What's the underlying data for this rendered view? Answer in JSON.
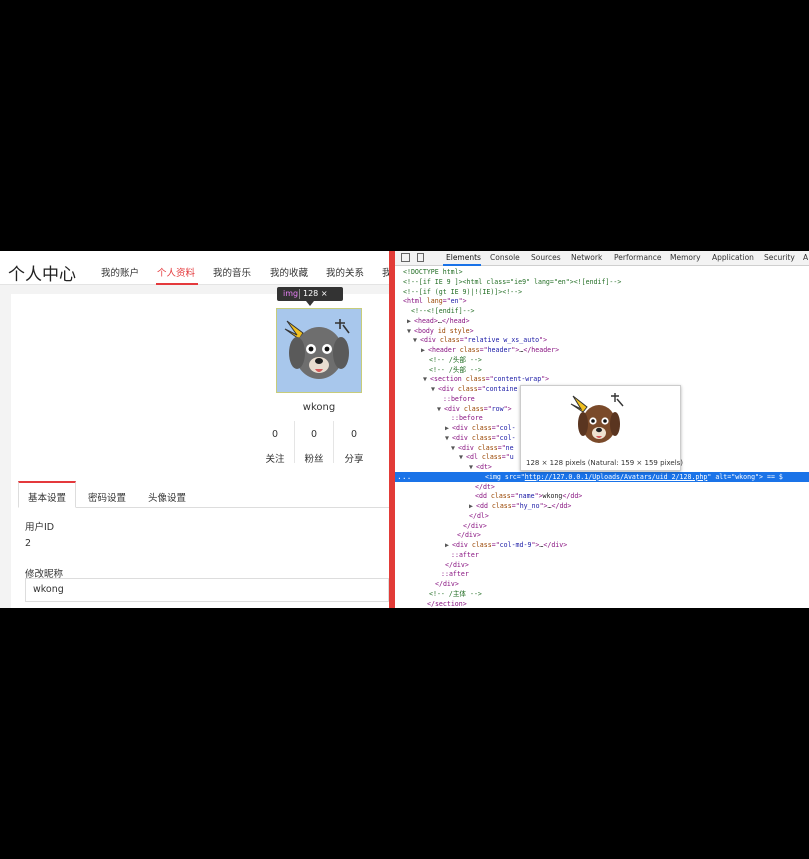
{
  "left": {
    "title": "个人中心",
    "nav": [
      "我的账户",
      "个人资料",
      "我的音乐",
      "我的收藏",
      "我的关系",
      "我"
    ],
    "active_nav": "个人资料",
    "tooltip": {
      "tag": "img",
      "dims": "128 × 128"
    },
    "username": "wkong",
    "stats": [
      {
        "value": "0",
        "label": "关注"
      },
      {
        "value": "0",
        "label": "粉丝"
      },
      {
        "value": "0",
        "label": "分享"
      }
    ],
    "tabs": [
      "基本设置",
      "密码设置",
      "头像设置"
    ],
    "active_tab": "基本设置",
    "user_id_label": "用户ID",
    "user_id_value": "2",
    "nickname_label": "修改昵称",
    "nickname_value": "wkong"
  },
  "devtools": {
    "tabs": [
      "Elements",
      "Console",
      "Sources",
      "Network",
      "Performance",
      "Memory",
      "Application",
      "Security",
      "A"
    ],
    "active_tab": "Elements",
    "preview_caption": "128 × 128 pixels (Natural: 159 × 159 pixels)",
    "selected_src": "http://127.0.0.1/Uploads/Avatars/uid_2/128.php",
    "selected_alt": "wkong",
    "selected_tail": "== $",
    "ellipsis": "...",
    "lines": [
      {
        "tri": "",
        "parts": [
          [
            "c-comment",
            "<!DOCTYPE html>"
          ]
        ]
      },
      {
        "tri": "",
        "parts": [
          [
            "c-comment",
            "<!--[if IE 9 ]><html class=\"ie9\" lang=\"en\"><![endif]-->"
          ]
        ]
      },
      {
        "tri": "",
        "parts": [
          [
            "c-comment",
            "<!--[if (gt IE 9)|!(IE)]><!-->"
          ]
        ]
      },
      {
        "tri": "",
        "parts": [
          [
            "c-tag",
            "<html "
          ],
          [
            "c-attr",
            "lang"
          ],
          [
            "c-tag",
            "=\""
          ],
          [
            "c-val",
            "en"
          ],
          [
            "c-tag",
            "\">"
          ]
        ]
      },
      {
        "tri": "",
        "parts": [
          [
            "c-comment",
            "<!--<![endif]-->"
          ]
        ]
      },
      {
        "tri": "▶",
        "parts": [
          [
            "c-tag",
            "<head>"
          ],
          [
            "c-text",
            "…"
          ],
          [
            "c-tag",
            "</head>"
          ]
        ]
      },
      {
        "tri": "▼",
        "parts": [
          [
            "c-tag",
            "<body "
          ],
          [
            "c-attr",
            "id style"
          ],
          [
            "c-tag",
            ">"
          ]
        ]
      },
      {
        "tri": "▼",
        "parts": [
          [
            "c-tag",
            "<div "
          ],
          [
            "c-attr",
            "class"
          ],
          [
            "c-tag",
            "=\""
          ],
          [
            "c-val",
            "relative w_xs_auto"
          ],
          [
            "c-tag",
            "\">"
          ]
        ]
      },
      {
        "tri": "▶",
        "parts": [
          [
            "c-tag",
            "<header "
          ],
          [
            "c-attr",
            "class"
          ],
          [
            "c-tag",
            "=\""
          ],
          [
            "c-val",
            "header"
          ],
          [
            "c-tag",
            "\">"
          ],
          [
            "c-text",
            "…"
          ],
          [
            "c-tag",
            "</header>"
          ]
        ]
      },
      {
        "tri": "",
        "parts": [
          [
            "c-comment",
            "<!-- /头部 -->"
          ]
        ]
      },
      {
        "tri": "",
        "parts": [
          [
            "c-comment",
            "<!-- /头部 -->"
          ]
        ]
      },
      {
        "tri": "▼",
        "parts": [
          [
            "c-tag",
            "<section "
          ],
          [
            "c-attr",
            "class"
          ],
          [
            "c-tag",
            "=\""
          ],
          [
            "c-val",
            "content-wrap"
          ],
          [
            "c-tag",
            "\">"
          ]
        ]
      },
      {
        "tri": "▼",
        "parts": [
          [
            "c-tag",
            "<div "
          ],
          [
            "c-attr",
            "class"
          ],
          [
            "c-tag",
            "=\""
          ],
          [
            "c-val",
            "containe"
          ]
        ]
      },
      {
        "tri": "",
        "parts": [
          [
            "c-pseudo",
            "::before"
          ]
        ]
      },
      {
        "tri": "▼",
        "parts": [
          [
            "c-tag",
            "<div "
          ],
          [
            "c-attr",
            "class"
          ],
          [
            "c-tag",
            "=\""
          ],
          [
            "c-val",
            "row"
          ],
          [
            "c-tag",
            "\">"
          ]
        ]
      },
      {
        "tri": "",
        "parts": [
          [
            "c-pseudo",
            "::before"
          ]
        ]
      },
      {
        "tri": "▶",
        "parts": [
          [
            "c-tag",
            "<div "
          ],
          [
            "c-attr",
            "class"
          ],
          [
            "c-tag",
            "=\""
          ],
          [
            "c-val",
            "col-"
          ]
        ]
      },
      {
        "tri": "▼",
        "parts": [
          [
            "c-tag",
            "<div "
          ],
          [
            "c-attr",
            "class"
          ],
          [
            "c-tag",
            "=\""
          ],
          [
            "c-val",
            "col-"
          ]
        ]
      },
      {
        "tri": "▼",
        "parts": [
          [
            "c-tag",
            "<div "
          ],
          [
            "c-attr",
            "class"
          ],
          [
            "c-tag",
            "=\""
          ],
          [
            "c-val",
            "ne"
          ]
        ]
      },
      {
        "tri": "▼",
        "parts": [
          [
            "c-tag",
            "<dl "
          ],
          [
            "c-attr",
            "class"
          ],
          [
            "c-tag",
            "=\""
          ],
          [
            "c-val",
            "u"
          ]
        ]
      },
      {
        "tri": "▼",
        "parts": [
          [
            "c-tag",
            "<dt>"
          ]
        ]
      },
      {
        "tri": "",
        "parts": []
      },
      {
        "tri": "",
        "parts": [
          [
            "c-tag",
            "</dt>"
          ]
        ]
      },
      {
        "tri": "",
        "parts": [
          [
            "c-tag",
            "<dd "
          ],
          [
            "c-attr",
            "class"
          ],
          [
            "c-tag",
            "=\""
          ],
          [
            "c-val",
            "name"
          ],
          [
            "c-tag",
            "\">"
          ],
          [
            "c-text",
            "wkong"
          ],
          [
            "c-tag",
            "</dd>"
          ]
        ]
      },
      {
        "tri": "▶",
        "parts": [
          [
            "c-tag",
            "<dd "
          ],
          [
            "c-attr",
            "class"
          ],
          [
            "c-tag",
            "=\""
          ],
          [
            "c-val",
            "hy_no"
          ],
          [
            "c-tag",
            "\">"
          ],
          [
            "c-text",
            "…"
          ],
          [
            "c-tag",
            "</dd>"
          ]
        ]
      },
      {
        "tri": "",
        "parts": [
          [
            "c-tag",
            "</dl>"
          ]
        ]
      },
      {
        "tri": "",
        "parts": [
          [
            "c-tag",
            "</div>"
          ]
        ]
      },
      {
        "tri": "",
        "parts": [
          [
            "c-tag",
            "</div>"
          ]
        ]
      },
      {
        "tri": "▶",
        "parts": [
          [
            "c-tag",
            "<div "
          ],
          [
            "c-attr",
            "class"
          ],
          [
            "c-tag",
            "=\""
          ],
          [
            "c-val",
            "col-md-9"
          ],
          [
            "c-tag",
            "\">"
          ],
          [
            "c-text",
            "…"
          ],
          [
            "c-tag",
            "</div>"
          ]
        ]
      },
      {
        "tri": "",
        "parts": [
          [
            "c-pseudo",
            "::after"
          ]
        ]
      },
      {
        "tri": "",
        "parts": [
          [
            "c-tag",
            "</div>"
          ]
        ]
      },
      {
        "tri": "",
        "parts": [
          [
            "c-pseudo",
            "::after"
          ]
        ]
      },
      {
        "tri": "",
        "parts": [
          [
            "c-tag",
            "</div>"
          ]
        ]
      },
      {
        "tri": "",
        "parts": [
          [
            "c-comment",
            "<!-- /主体 -->"
          ]
        ]
      },
      {
        "tri": "",
        "parts": [
          [
            "c-tag",
            "</section>"
          ]
        ]
      }
    ]
  }
}
